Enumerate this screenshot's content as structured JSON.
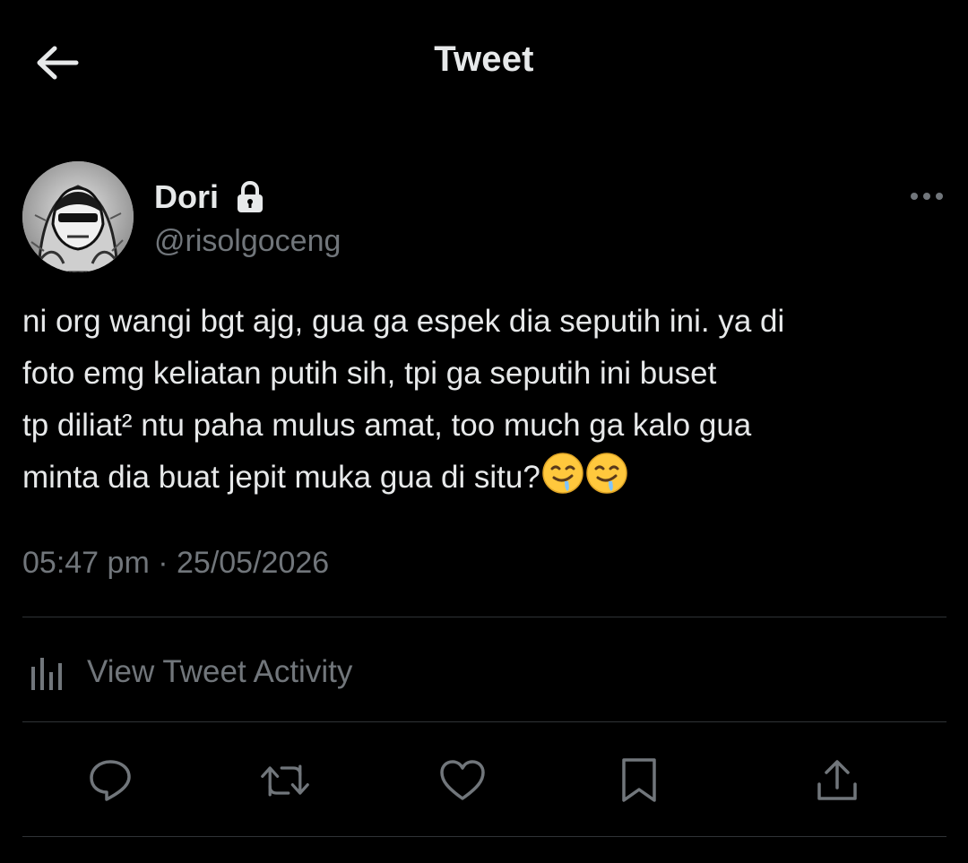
{
  "header": {
    "title": "Tweet",
    "back_icon": "arrow-left-icon"
  },
  "author": {
    "display_name": "Dori",
    "handle": "@risolgoceng",
    "protected": true,
    "lock_icon": "lock-icon"
  },
  "tweet": {
    "lines": [
      "ni org wangi bgt ajg, gua ga espek dia seputih ini. ya di",
      "foto emg keliatan putih sih, tpi ga seputih ini buset",
      "tp diliat² ntu paha mulus amat, too much ga kalo gua",
      "minta dia buat jepit muka gua di situ?"
    ],
    "emoji": [
      "drooling-face-emoji",
      "drooling-face-emoji"
    ],
    "time": "05:47 pm",
    "separator": "·",
    "date": "25/05/2026"
  },
  "activity": {
    "label": "View Tweet Activity",
    "icon": "bar-chart-icon"
  },
  "actions": [
    {
      "name": "reply",
      "icon": "reply-icon"
    },
    {
      "name": "retweet",
      "icon": "retweet-icon"
    },
    {
      "name": "like",
      "icon": "heart-icon"
    },
    {
      "name": "bookmark",
      "icon": "bookmark-icon"
    },
    {
      "name": "share",
      "icon": "share-icon"
    }
  ],
  "colors": {
    "background": "#000000",
    "primary_text": "#e7e9ea",
    "secondary_text": "#71767b",
    "divider": "#2f3336"
  }
}
